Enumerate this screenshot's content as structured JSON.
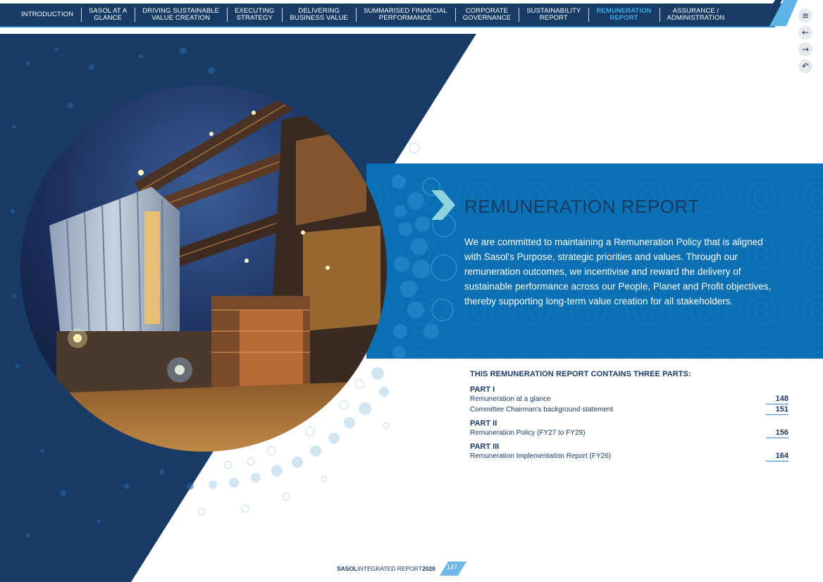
{
  "nav": {
    "items": [
      {
        "line1": "INTRODUCTION",
        "line2": ""
      },
      {
        "line1": "SASOL AT A",
        "line2": "GLANCE"
      },
      {
        "line1": "DRIVING SUSTAINABLE",
        "line2": "VALUE CREATION"
      },
      {
        "line1": "EXECUTING",
        "line2": "STRATEGY"
      },
      {
        "line1": "DELIVERING",
        "line2": "BUSINESS VALUE"
      },
      {
        "line1": "SUMMARISED FINANCIAL",
        "line2": "PERFORMANCE"
      },
      {
        "line1": "CORPORATE",
        "line2": "GOVERNANCE"
      },
      {
        "line1": "SUSTAINABILITY",
        "line2": "REPORT"
      },
      {
        "line1": "REMUNERATION",
        "line2": "REPORT"
      },
      {
        "line1": "ASSURANCE /",
        "line2": "ADMINISTRATION"
      }
    ],
    "active_index": 8
  },
  "side_controls": [
    {
      "icon": "menu-icon",
      "glyph": "≡"
    },
    {
      "icon": "arrow-left-icon",
      "glyph": "←"
    },
    {
      "icon": "arrow-right-icon",
      "glyph": "→"
    },
    {
      "icon": "return-icon",
      "glyph": "↶"
    }
  ],
  "main": {
    "title": "REMUNERATION REPORT",
    "intro": "We are committed to maintaining a Remuneration Policy that is aligned with Sasol's Purpose, strategic priorities and values. Through our remuneration outcomes, we incentivise and reward the delivery of sustainable performance across our People, Planet and Profit objectives, thereby supporting long-term value creation for all stakeholders."
  },
  "contents": {
    "heading": "THIS REMUNERATION REPORT CONTAINS THREE PARTS:",
    "parts": [
      {
        "title": "PART I",
        "entries": [
          {
            "label": "Remuneration at a glance",
            "page": "148"
          },
          {
            "label": "Committee Chairman's background statement",
            "page": "151"
          }
        ]
      },
      {
        "title": "PART II",
        "entries": [
          {
            "label": "Remuneration Policy (FY27 to FY29)",
            "page": "156"
          }
        ]
      },
      {
        "title": "PART III",
        "entries": [
          {
            "label": "Remuneration Implementation Report (FY26)",
            "page": "164"
          }
        ]
      }
    ]
  },
  "footer": {
    "brand": "SASOL",
    "report": " INTEGRATED REPORT ",
    "year": "2026",
    "page": "147"
  },
  "colors": {
    "navy": "#183b66",
    "band_blue": "#0b6fb3",
    "active_nav": "#3aa9e8",
    "chevron": "#8ed3de"
  }
}
